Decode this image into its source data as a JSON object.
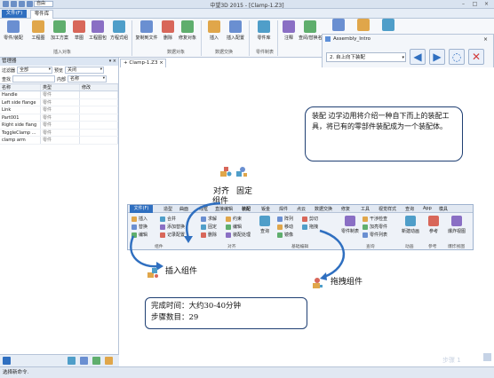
{
  "window": {
    "title": "中望3D 2015 - [Clamp-1.Z3]",
    "edit_chip": "自由",
    "minimize": "–",
    "maximize": "□",
    "close": "×"
  },
  "menubar": {
    "file": "文件(F)",
    "tab_active": "零件库"
  },
  "ribbon": {
    "buttons": [
      "零件/装配",
      "工程图",
      "加工方案",
      "草图",
      "工程图包",
      "方程式组",
      "复制到文件",
      "删除",
      "修复对象",
      "插入",
      "插入配置",
      "零件库",
      "注释",
      "查阅/替换名称"
    ],
    "groups": [
      "插入对象",
      "数据对象",
      "数据交换",
      "零件制表"
    ]
  },
  "assembly_panel": {
    "title": "Assembly_Intro",
    "close": "×",
    "select": "2. 自上向下装配"
  },
  "left_panel": {
    "header": "管理器",
    "pin": "▾ ×",
    "filter_label": "过滤器",
    "filter_value": "全部",
    "preview_label": "预览",
    "preview_value": "关闭",
    "search_label": "查找",
    "inner_label": "内部",
    "inner_value": "名称",
    "columns": [
      "名称",
      "类型",
      "修改"
    ],
    "rows": [
      [
        "Handle",
        "零件",
        ""
      ],
      [
        "Left side flange",
        "零件",
        ""
      ],
      [
        "Link",
        "零件",
        ""
      ],
      [
        "Part001",
        "零件",
        ""
      ],
      [
        "Right side flang",
        "零件",
        ""
      ],
      [
        "ToggleClamp ...",
        "零件",
        ""
      ],
      [
        "clamp arm",
        "零件",
        ""
      ]
    ]
  },
  "doc_tab": "Clamp-1.Z3",
  "callout": "装配 边学边用将介绍一种自下而上的装配工具，将已有的零部件装配成为一个装配体。",
  "labels": {
    "align": "对齐",
    "component": "组件",
    "fix": "固定",
    "insert_component": "插入组件",
    "drag_component": "拖拽组件"
  },
  "sub_ribbon": {
    "file": "文件(F)",
    "tabs": [
      "造型",
      "曲面",
      "线框",
      "直接编辑",
      "装配",
      "钣金",
      "焊件",
      "点云",
      "数据交换",
      "修复",
      "工具",
      "视觉样式",
      "查询",
      "App",
      "模具"
    ],
    "buttons_small": [
      "插入",
      "替换",
      "编辑",
      "合并",
      "添加替换",
      "记录配置",
      "求解",
      "固定",
      "删除",
      "约束",
      "编辑",
      "装配处理",
      "阵列",
      "移动",
      "镜像",
      "剪切",
      "拖拽",
      "零件制表",
      "干涉检查",
      "加亮零件",
      "零件列表",
      "新建动画",
      "参考",
      "爆炸视图"
    ],
    "buttons_big": [
      "查询",
      "零件制表",
      "新建动画",
      "参考",
      "爆炸视图"
    ],
    "groups": [
      "组件",
      "对齐",
      "基础编辑",
      "查询",
      "动画",
      "参考",
      "爆炸视图"
    ]
  },
  "info": {
    "time": "完成时间：大约30-40分钟",
    "steps": "步骤数目：29"
  },
  "status": "选择新命令.",
  "watermark": "步骤 1"
}
